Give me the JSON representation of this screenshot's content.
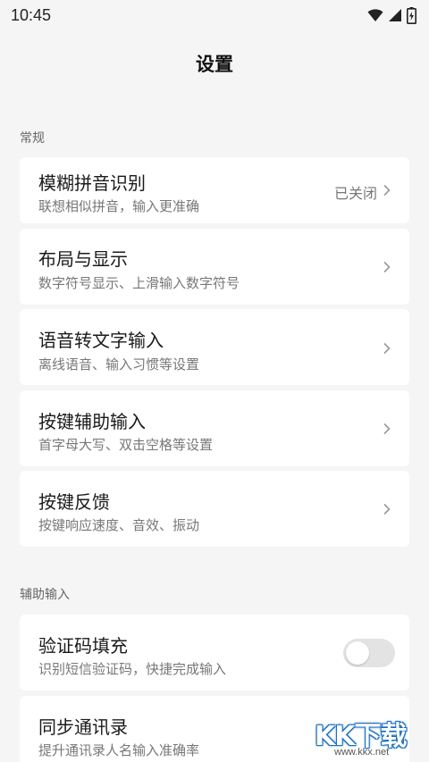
{
  "status_bar": {
    "time": "10:45"
  },
  "header": {
    "title": "设置"
  },
  "sections": [
    {
      "label": "常规"
    },
    {
      "label": "辅助输入"
    }
  ],
  "items": [
    {
      "title": "模糊拼音识别",
      "subtitle": "联想相似拼音，输入更准确",
      "value": "已关闭"
    },
    {
      "title": "布局与显示",
      "subtitle": "数字符号显示、上滑输入数字符号"
    },
    {
      "title": "语音转文字输入",
      "subtitle": "离线语音、输入习惯等设置"
    },
    {
      "title": "按键辅助输入",
      "subtitle": "首字母大写、双击空格等设置"
    },
    {
      "title": "按键反馈",
      "subtitle": "按键响应速度、音效、振动"
    },
    {
      "title": "验证码填充",
      "subtitle": "识别短信验证码，快捷完成输入",
      "toggle_on": false
    },
    {
      "title": "同步通讯录",
      "subtitle": "提升通讯录人名输入准确率"
    }
  ],
  "watermark": {
    "logo": "KK下载",
    "url": "www.kkx.net"
  },
  "colors": {
    "background": "#f5f5f5",
    "card": "#ffffff",
    "toggle_off": "#e3e3e3"
  }
}
